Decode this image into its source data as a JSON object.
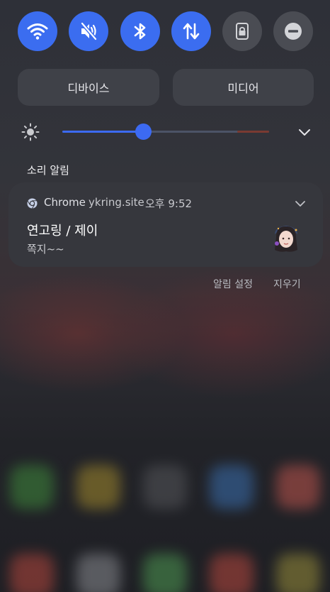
{
  "quick_settings": {
    "tiles": [
      {
        "name": "wifi",
        "state": "on"
      },
      {
        "name": "sound-muted",
        "state": "on"
      },
      {
        "name": "bluetooth",
        "state": "on"
      },
      {
        "name": "mobile-data",
        "state": "on"
      },
      {
        "name": "screen-lock",
        "state": "off"
      },
      {
        "name": "do-not-disturb",
        "state": "off"
      }
    ]
  },
  "modes": {
    "device_label": "디바이스",
    "media_label": "미디어"
  },
  "brightness": {
    "level": 0.39
  },
  "notifications": {
    "section_title": "소리 알림",
    "card": {
      "app_name": "Chrome",
      "site": "ykring.site",
      "time": "오후 9:52",
      "title": "연고링 / 제이",
      "body": "쪽지~~"
    },
    "actions": {
      "settings_label": "알림 설정",
      "clear_label": "지우기"
    }
  },
  "colors": {
    "accent": "#3b6df0",
    "tile_off": "#4a4c53",
    "card": "#36373d"
  }
}
